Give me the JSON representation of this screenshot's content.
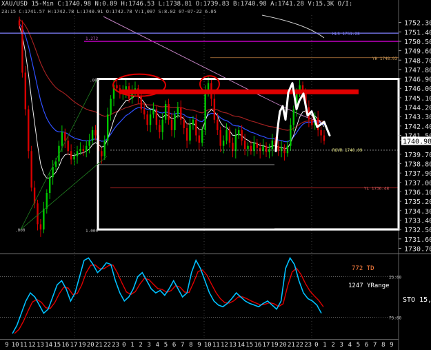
{
  "header": {
    "line1": "XAU/USD 15-Min C:1740.98 N:0.89 H:1746.53 L:1738.81 O:1739.83 B:1740.98 A:1741.28 V:15.3K O/I:",
    "line2": "23:15 C:1741.57 H:1742.78 L:1740.91 O:1742.78 V:1,097 S:8.02 07-07-22 6.05"
  },
  "price_axis": {
    "labels": [
      "1752.30",
      "1751.40",
      "1750.50",
      "1749.60",
      "1748.70",
      "1747.80",
      "1746.90",
      "1746.00",
      "1745.10",
      "1744.20",
      "1743.30",
      "1742.40",
      "1741.50",
      "1740.98",
      "1739.70",
      "1738.80",
      "1737.90",
      "1737.00",
      "1736.10",
      "1735.20",
      "1734.30",
      "1733.40",
      "1732.50",
      "1731.60",
      "1730.70"
    ],
    "current_price": "1740.98"
  },
  "annotations": {
    "hls": "HLS 1751.28",
    "fib_top": "1.272",
    "yh": "YH 1748.93",
    "box_zero": ".000",
    "ovr": "ROVR 1740.09",
    "yl": "YL 1736.48",
    "box_one": "1.000",
    "low_zero": ".000"
  },
  "oscillator": {
    "label_td": "772 TD",
    "label_yrange": "1247 YRange",
    "label_sto": "STO 15,",
    "level_high": "25.00",
    "level_low": "75.00"
  },
  "time_axis": {
    "labels": [
      "9",
      "10",
      "11",
      "12",
      "13",
      "14",
      "15",
      "16",
      "17",
      "19",
      "20",
      "21",
      "22",
      "23",
      "0",
      "1",
      "2",
      "3",
      "4",
      "5",
      "6",
      "7",
      "8",
      "9",
      "10",
      "11",
      "12",
      "13",
      "14",
      "15",
      "16",
      "17",
      "19",
      "20",
      "21",
      "22",
      "23",
      "0",
      "1",
      "2",
      "3",
      "4",
      "5",
      "6",
      "7",
      "8",
      "9"
    ]
  },
  "colors": {
    "bull": "#00c800",
    "bear": "#d80000",
    "box": "#ffffff",
    "hls_line": "#8080ff",
    "fib_line": "#c000c0",
    "resistance": "#e00000",
    "stoch_k": "#00c0ff",
    "stoch_d": "#e00000"
  },
  "chart_data": {
    "type": "candlestick",
    "symbol": "XAU/USD",
    "timeframe": "15-Min",
    "ylim": [
      1730.2,
      1753.0
    ],
    "closes": [
      1752.0,
      1747.5,
      1744.0,
      1740.0,
      1736.5,
      1735.0,
      1733.0,
      1732.5,
      1734.5,
      1736.0,
      1737.5,
      1738.5,
      1739.0,
      1740.5,
      1741.8,
      1741.0,
      1740.0,
      1739.2,
      1739.5,
      1740.0,
      1740.2,
      1740.0,
      1740.5,
      1741.0,
      1742.0,
      1741.5,
      1740.0,
      1739.5,
      1741.0,
      1743.5,
      1745.0,
      1746.3,
      1746.0,
      1745.5,
      1745.8,
      1746.2,
      1745.0,
      1745.8,
      1746.0,
      1745.2,
      1744.0,
      1743.5,
      1742.5,
      1743.5,
      1744.0,
      1742.5,
      1741.8,
      1743.0,
      1744.5,
      1743.0,
      1742.0,
      1743.5,
      1744.2,
      1743.0,
      1742.2,
      1741.0,
      1742.5,
      1743.0,
      1741.5,
      1740.8,
      1742.0,
      1745.8,
      1746.5,
      1745.0,
      1743.0,
      1742.0,
      1740.5,
      1741.0,
      1742.0,
      1740.8,
      1740.0,
      1741.5,
      1742.0,
      1741.0,
      1740.2,
      1740.5,
      1740.0,
      1740.8,
      1740.3,
      1740.0,
      1740.5,
      1739.9,
      1740.2,
      1741.0,
      1740.5,
      1740.0,
      1740.3,
      1739.8,
      1740.5,
      1742.5,
      1744.0,
      1745.5,
      1746.3,
      1745.5,
      1744.2,
      1743.0,
      1742.5,
      1743.2,
      1742.0,
      1741.5,
      1740.98
    ],
    "series": [
      {
        "name": "STO",
        "values": [
          5,
          15,
          30,
          45,
          55,
          50,
          40,
          30,
          35,
          50,
          65,
          70,
          60,
          45,
          55,
          75,
          95,
          98,
          90,
          80,
          85,
          92,
          90,
          70,
          55,
          45,
          50,
          60,
          75,
          80,
          70,
          60,
          55,
          58,
          52,
          60,
          70,
          60,
          50,
          55,
          80,
          95,
          85,
          70,
          55,
          45,
          40,
          38,
          42,
          48,
          55,
          50,
          45,
          42,
          40,
          38,
          42,
          45,
          40,
          35,
          45,
          85,
          98,
          90,
          70,
          55,
          48,
          45,
          40,
          30
        ]
      }
    ],
    "oscillator_ylim": [
      0,
      100
    ]
  }
}
